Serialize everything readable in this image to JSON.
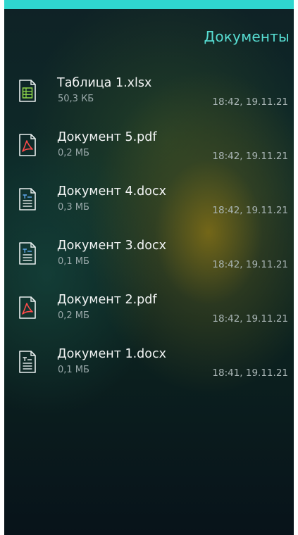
{
  "header": {
    "title": "Документы"
  },
  "files": [
    {
      "name": "Таблица 1.xlsx",
      "size": "50,3 КБ",
      "modified": "18:42, 19.11.21",
      "icon": "spreadsheet-icon"
    },
    {
      "name": "Документ 5.pdf",
      "size": "0,2 МБ",
      "modified": "18:42, 19.11.21",
      "icon": "pdf-icon"
    },
    {
      "name": "Документ 4.docx",
      "size": "0,3 МБ",
      "modified": "18:42, 19.11.21",
      "icon": "text-document-icon"
    },
    {
      "name": "Документ 3.docx",
      "size": "0,1 МБ",
      "modified": "18:42, 19.11.21",
      "icon": "text-document-icon"
    },
    {
      "name": "Документ 2.pdf",
      "size": "0,2 МБ",
      "modified": "18:42, 19.11.21",
      "icon": "pdf-icon"
    },
    {
      "name": "Документ 1.docx",
      "size": "0,1 МБ",
      "modified": "18:41, 19.11.21",
      "icon": "text-document-icon"
    }
  ],
  "colors": {
    "accent": "#2fd6cf",
    "title": "#57ddd2",
    "text_primary": "#f2f4f4",
    "text_secondary": "#9aa9aa"
  }
}
